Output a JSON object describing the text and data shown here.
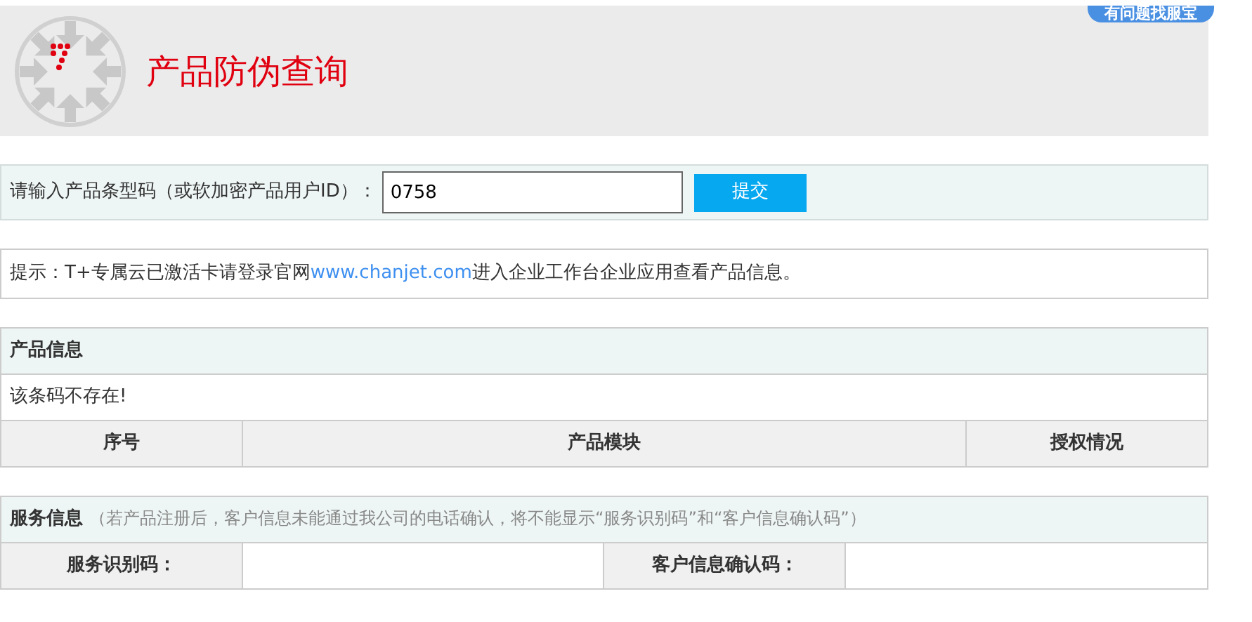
{
  "help_badge": "有问题找服宝",
  "header": {
    "title": "产品防伪查询"
  },
  "query": {
    "label": "请输入产品条型码（或软加密产品用户ID）：",
    "value": "0758",
    "button": "提交"
  },
  "tip": {
    "text": "提示：T+专属云已激活卡请登录官网",
    "link": "www.chanjet.com",
    "text_after": "进入企业工作台企业应用查看产品信息。"
  },
  "product_info": {
    "title": "产品信息",
    "message": "该条码不存在!",
    "columns": [
      "序号",
      "产品模块",
      "授权情况"
    ]
  },
  "service_info": {
    "title": "服务信息",
    "note": "（若产品注册后，客户信息未能通过我公司的电话确认，将不能显示“服务识别码”和“客户信息确认码”）",
    "fields": [
      {
        "label": "服务识别码："
      },
      {
        "label": "客户信息确认码："
      }
    ]
  }
}
